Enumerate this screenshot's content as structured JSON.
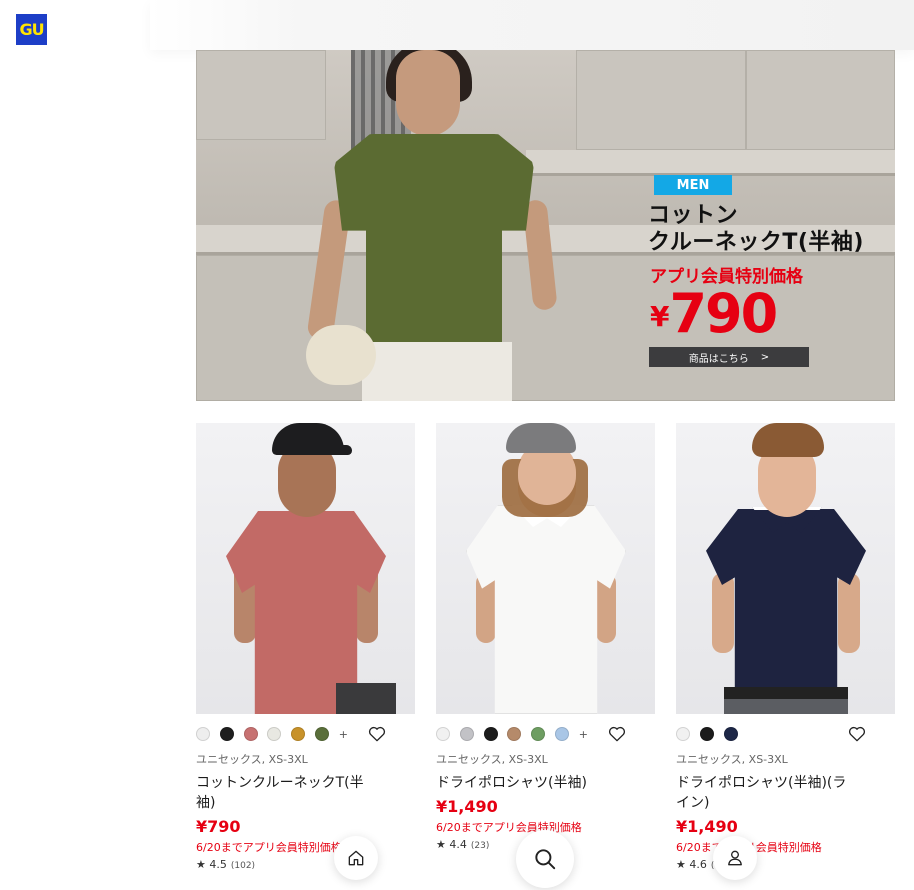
{
  "header": {
    "logo_text": "GU"
  },
  "banner": {
    "tag": "MEN",
    "title": "コットン\nクルーネックT(半袖)",
    "promo": "アプリ会員特別価格",
    "price_symbol": "¥",
    "price": "790",
    "cta": "商品はこちら",
    "cta_arrow": ">"
  },
  "products": [
    {
      "meta": "ユニセックス, XS-3XL",
      "name": "コットンクルーネックT(半袖)",
      "price": "¥790",
      "note": "6/20までアプリ会員特別価格",
      "rating": "★ 4.5",
      "reviews": "(102)",
      "swatches": [
        "#eeeeee",
        "#1e1e1e",
        "#c77171",
        "#e8e8e2",
        "#c8922a",
        "#5a6f3a"
      ],
      "more": "+"
    },
    {
      "meta": "ユニセックス, XS-3XL",
      "name": "ドライポロシャツ(半袖)",
      "price": "¥1,490",
      "note": "6/20までアプリ会員特別価格",
      "rating": "★ 4.4",
      "reviews": "(23)",
      "swatches": [
        "#f1f1f1",
        "#c2c2c6",
        "#1c1c1c",
        "#b58a6a",
        "#6e9e62",
        "#a9c6e6"
      ],
      "more": "+"
    },
    {
      "meta": "ユニセックス, XS-3XL",
      "name": "ドライポロシャツ(半袖)(ライン)",
      "price": "¥1,490",
      "note": "6/20までアプリ会員特別価格",
      "rating": "★ 4.6",
      "reviews": "(11)",
      "swatches": [
        "#f1f1f1",
        "#1b1b1b",
        "#1d2747"
      ],
      "more": ""
    }
  ],
  "bottom_nav": {
    "home_icon": "home-icon",
    "search_icon": "search-icon",
    "account_icon": "user-icon"
  },
  "colors": {
    "brand_blue": "#1d3ec7",
    "brand_yellow": "#ffe400",
    "sale_red": "#e60012",
    "banner_tag": "#13a8e6"
  }
}
